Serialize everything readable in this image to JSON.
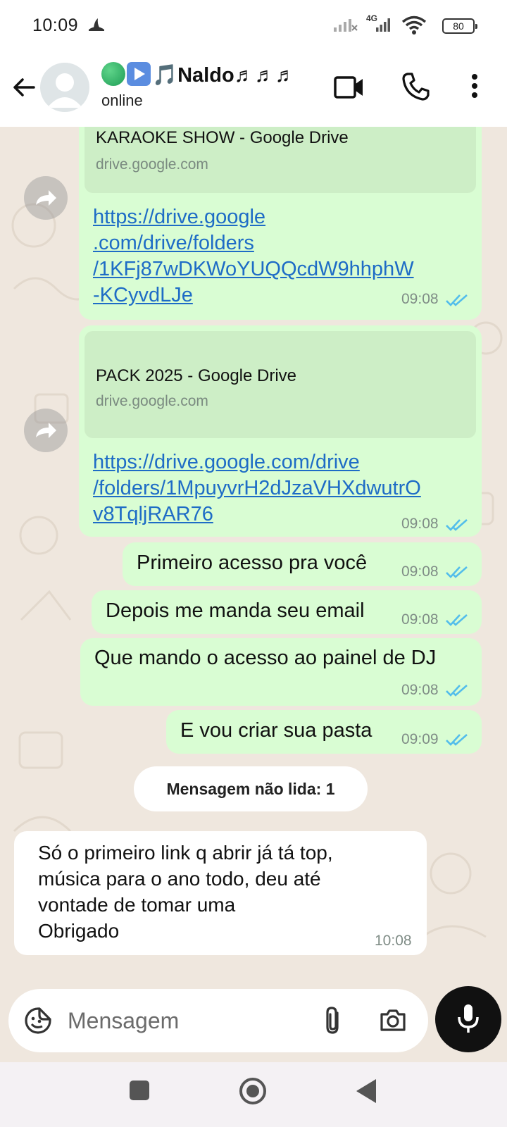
{
  "status_bar": {
    "time": "10:09",
    "network": "4G",
    "battery": "80"
  },
  "header": {
    "contact_name": "🎵Naldo♬♬♬",
    "status": "online",
    "icons": [
      "back-arrow-icon",
      "avatar",
      "video-call-icon",
      "phone-call-icon",
      "more-vert-icon"
    ]
  },
  "messages": [
    {
      "direction": "out",
      "preview_title": "KARAOKE SHOW - Google Drive",
      "preview_domain": "drive.google.com",
      "text": "https://drive.google\n.com/drive/folders\n/1KFj87wDKWoYUQQcdW9hhphW\n-KCyvdLJe",
      "time": "09:08",
      "read": true
    },
    {
      "direction": "out",
      "preview_title": "PACK 2025 - Google Drive",
      "preview_domain": "drive.google.com",
      "text": "https://drive.google.com/drive\n/folders/1MpuyvrH2dJzaVHXdwutrO\nv8TqljRAR76",
      "time": "09:08",
      "read": true
    },
    {
      "direction": "out",
      "text": "Primeiro acesso pra você",
      "time": "09:08",
      "read": true
    },
    {
      "direction": "out",
      "text": "Depois me manda seu email",
      "time": "09:08",
      "read": true
    },
    {
      "direction": "out",
      "text": "Que mando o acesso ao painel de DJ",
      "time": "09:08",
      "read": true
    },
    {
      "direction": "out",
      "text": "E vou criar sua pasta",
      "time": "09:09",
      "read": true
    },
    {
      "direction": "in",
      "text": "Só o primeiro link q abrir já tá top,\nmúsica para o ano todo, deu até\nvontade de tomar uma\nObrigado",
      "time": "10:08"
    }
  ],
  "unread_banner": "Mensagem não lida: 1",
  "composer": {
    "placeholder": "Mensagem",
    "icons": [
      "sticker-icon",
      "attach-icon",
      "camera-icon",
      "mic-icon"
    ]
  },
  "colors": {
    "outgoing_bubble": "#d9fdd3",
    "incoming_bubble": "#ffffff",
    "link": "#1e6cc6",
    "read_ticks": "#53bdeb",
    "wallpaper": "#efe7de"
  }
}
